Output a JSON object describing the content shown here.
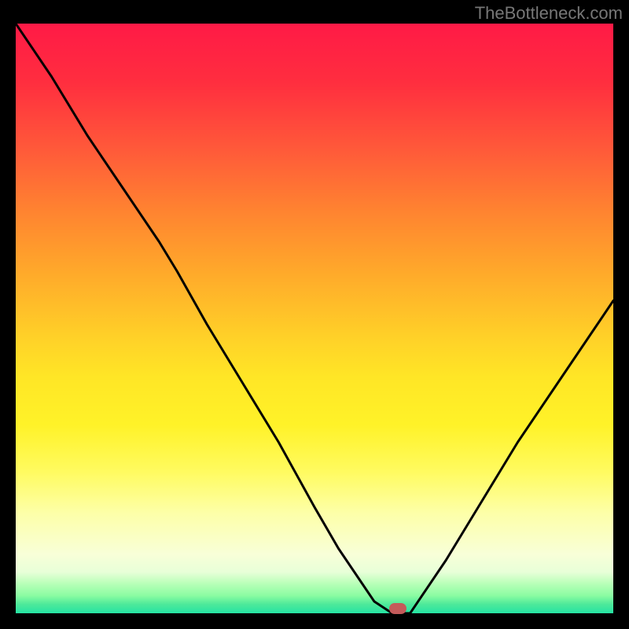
{
  "watermark": "TheBottleneck.com",
  "colors": {
    "curve": "#000000",
    "marker": "#c45a5a",
    "frame": "#000000"
  },
  "marker": {
    "x_pct": 64,
    "y_pct": 99.2
  },
  "chart_data": {
    "type": "line",
    "title": "",
    "xlabel": "",
    "ylabel": "",
    "xlim": [
      0,
      100
    ],
    "ylim": [
      0,
      100
    ],
    "grid": false,
    "legend": false,
    "series": [
      {
        "name": "bottleneck-curve",
        "x_pct": [
          0,
          6,
          12,
          18,
          24,
          27,
          32,
          38,
          44,
          50,
          54,
          58,
          60,
          63,
          66,
          72,
          78,
          84,
          90,
          96,
          100
        ],
        "y_pct": [
          100,
          91,
          81,
          72,
          63,
          58,
          49,
          39,
          29,
          18,
          11,
          5,
          2,
          0,
          0,
          9,
          19,
          29,
          38,
          47,
          53
        ]
      }
    ],
    "marker_point": {
      "x_pct": 64,
      "y_pct": 0
    },
    "background_gradient": {
      "top": "#ff1a46",
      "mid": "#fff228",
      "bottom": "#25e3a3"
    }
  }
}
